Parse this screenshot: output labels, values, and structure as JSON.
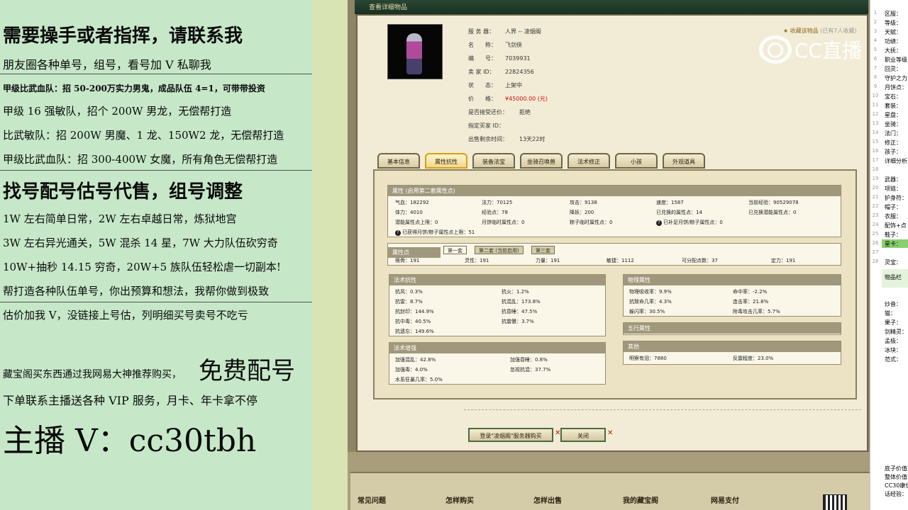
{
  "overlay": {
    "lines": [
      "需要操手或者指挥，请联系我",
      "朋友圈各种单号，组号，看号加 V 私聊我",
      "甲级比武血队：招 50-200万实力男鬼，成品队伍 4=1，可带带投资",
      "甲级 16 强敏队，招个 200W 男龙，无偿帮打造",
      "比武敏队：招 200W 男魔、1 龙、150W2 龙，无偿帮打造",
      "甲级比武血队：招 300-400W 女魔，所有角色无偿帮打造",
      "找号配号估号代售，组号调整",
      "1W 左右简单日常，2W 左右卓越日常，炼狱地宫",
      "3W 左右异光通关，5W 混杀 14 星，7W 大力队伍砍穷奇",
      "10W+抽秒 14.15 穷奇，20W+5 族队伍轻松虐一切副本!",
      "帮打造各种队伍单号，你出预算和想法，我帮你做到极致",
      "估价加我 V，没链接上号估，列明细买号卖号不吃亏",
      "藏宝阁买东西通过我网易大神推荐购买，",
      "免费配号",
      "下单联系主播送各种 VIP 服务，月卡、年卡拿不停",
      "主播 V：cc30tbh"
    ]
  },
  "window": {
    "title": "查看详细物品",
    "info": [
      {
        "k": "服 务 器：",
        "v": "人界 -- 凌烟阁"
      },
      {
        "k": "名　　称：",
        "v": "飞剑侠"
      },
      {
        "k": "编　　号：",
        "v": "7039931"
      },
      {
        "k": "卖 家 ID：",
        "v": "22824356"
      },
      {
        "k": "状　　态：",
        "v": "上架中"
      },
      {
        "k": "价　　格：",
        "v": "¥45000.00 (元)"
      },
      {
        "k": "是否接受还价：",
        "v": "拒绝"
      },
      {
        "k": "指定买家 ID：",
        "v": ""
      },
      {
        "k": "出售剩余时间：",
        "v": "13天22时"
      }
    ],
    "fav_label": "收藏该物品",
    "fav_count": "(已有7人收藏)",
    "tabs": [
      "基本信息",
      "属性抗性",
      "装备法宝",
      "坐骑召唤兽",
      "法术修正",
      "小孩",
      "外观道具"
    ],
    "attr": {
      "header": "属性 (启用第二套属性点)",
      "rows": [
        [
          "气血：182292",
          "法力：70125",
          "攻击：9138",
          "速度：1587",
          "当前经验：90529078"
        ],
        [
          "体力：4010",
          "经验点：78",
          "降妖：200",
          "已兑换的属性点：14",
          "已兑换潜能属性点：0"
        ],
        [
          "潜能属性点上限：0",
          "月饼临时属性点：0",
          "粽子临时属性点：0",
          "已补足月饼/粽子属性点：0",
          ""
        ]
      ],
      "note": "已获得月饼/粽子属性点上限：51"
    },
    "points": {
      "header": "属性点",
      "subtabs": [
        "第一套",
        "第二套 (当前启用)",
        "第三套"
      ],
      "values": [
        "根骨：191",
        "灵性：191",
        "力量：191",
        "敏捷：1112",
        "可分配点数：37",
        "定力：191"
      ]
    },
    "resist": {
      "header": "法术抗性",
      "items": [
        "抗风：0.3%",
        "抗火：1.2%",
        "抗雷：8.7%",
        "抗混乱：173.8%",
        "抗封印：144.9%",
        "抗昏睡：47.5%",
        "抗中毒：40.5%",
        "抗震慑：3.7%",
        "抗遗忘：149.6%"
      ]
    },
    "boost": {
      "header": "法术增强",
      "items": [
        "加强混乱：42.8%",
        "加强昏睡：0.8%",
        "加强毒：4.0%",
        "忽视抗混：37.7%",
        "水系狂暴几率：5.0%"
      ]
    },
    "physical": {
      "header": "物理属性",
      "items": [
        "物理吸收率：9.9%",
        "命中率：-2.2%",
        "抗致命几率：4.3%",
        "连击率：21.8%",
        "躲闪率：30.5%",
        "附毒攻击几率：5.7%"
      ]
    },
    "five": {
      "header": "五行属性"
    },
    "other": {
      "header": "其他",
      "items": [
        "明察有泪：7880",
        "反震程度：23.0%"
      ]
    },
    "buttons": {
      "buy": "登录\"凌烟阁\"服务器购买",
      "close": "关闭"
    },
    "footer": [
      "常见问题",
      "怎样购买",
      "怎样出售",
      "我的藏宝阁",
      "网易支付"
    ]
  },
  "sidebar": {
    "rows": [
      "区服：",
      "等级：",
      "天赋：",
      "功绩：",
      "大抚：",
      "职业等级",
      "回灵：",
      "守护之力",
      "月饼点：",
      "宝石：",
      "套装：",
      "星盘：",
      "坐骑：",
      "法门：",
      "修正：",
      "孩子：",
      "详细分析",
      "",
      "武器：",
      "项链：",
      "护身符：",
      "帽子：",
      "衣服：",
      "配饰+点",
      "鞋子：",
      "星卡：",
      "",
      "灵宝："
    ],
    "numbers": [
      "1",
      "2",
      "3",
      "4",
      "5",
      "6",
      "7",
      "8",
      "9",
      "10",
      "11",
      "12",
      "13",
      "14",
      "15",
      "16",
      "17",
      "18",
      "19",
      "20",
      "21",
      "22",
      "23",
      "24",
      "25",
      "26",
      "27",
      "28"
    ],
    "group_label": "物品栏",
    "rows2": [
      "炒音：",
      "猫：",
      "果子：",
      "剑精灵：",
      "孟极：",
      "冰块：",
      "范式："
    ],
    "bottom": [
      "底子价值",
      "整体价值",
      "CC30康价",
      "话经验："
    ]
  },
  "logo": {
    "text": "CC直播"
  }
}
